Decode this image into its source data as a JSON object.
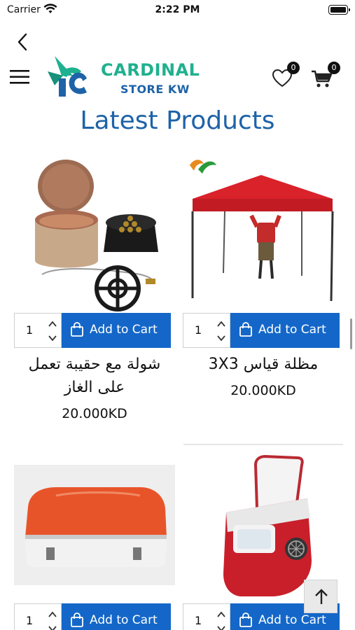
{
  "status_bar": {
    "carrier": "Carrier",
    "time": "2:22 PM"
  },
  "header": {
    "brand": "CARDINAL",
    "subtitle": "STORE KW",
    "wishlist_count": "0",
    "cart_count": "0",
    "icons": {
      "back": "chevron-left-icon",
      "menu": "hamburger-icon",
      "wishlist": "heart-icon",
      "cart": "cart-icon"
    }
  },
  "page_title": "Latest Products",
  "products": [
    {
      "name": "شولة مع حقيبة تعمل على الغاز",
      "price": "20.000KD",
      "qty": "1",
      "button": "Add to Cart"
    },
    {
      "name": "مظلة قياس 3X3",
      "price": "20.000KD",
      "qty": "1",
      "button": "Add to Cart"
    },
    {
      "name": "",
      "price": "",
      "qty": "1",
      "button": "Add to Cart"
    },
    {
      "name": "",
      "price": "",
      "qty": "1",
      "button": "Add to Cart"
    }
  ],
  "colors": {
    "accent_blue": "#1467c8",
    "title_blue": "#1e63a8",
    "brand_green": "#1fb08f",
    "tent_red": "#d9222a",
    "case_orange": "#e8542a",
    "ice_maker_red": "#c91f2b"
  }
}
